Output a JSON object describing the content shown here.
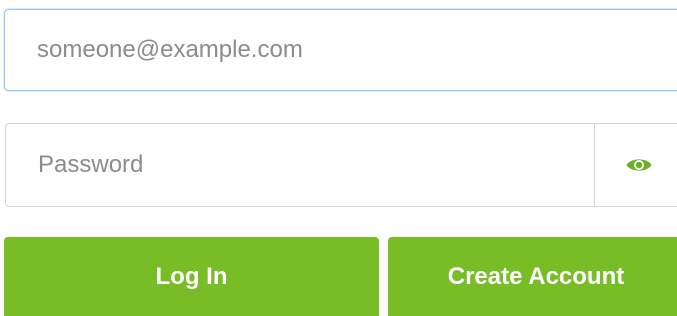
{
  "email": {
    "placeholder": "someone@example.com",
    "value": ""
  },
  "password": {
    "placeholder": "Password",
    "value": "",
    "toggle_icon": "eye-icon"
  },
  "actions": {
    "login_label": "Log In",
    "create_label": "Create Account"
  },
  "colors": {
    "primary_green": "#78bc26",
    "eye_green": "#6ab024",
    "focus_border": "#9cc7ee",
    "border": "#d6d6d6",
    "placeholder": "#8c8c8c"
  }
}
